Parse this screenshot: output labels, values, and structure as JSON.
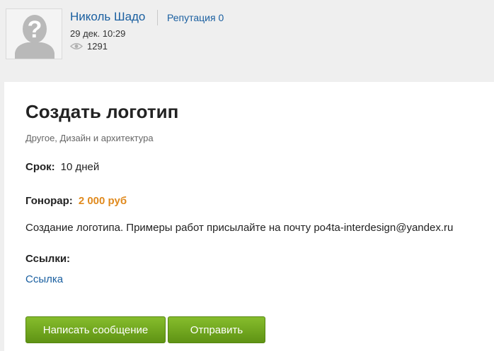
{
  "author": {
    "name": "Николь Шадо",
    "reputation": "Репутация 0",
    "date": "29 дек. 10:29",
    "views": "1291",
    "avatar_icon": "default-avatar-icon",
    "views_icon": "eye-icon"
  },
  "task": {
    "title": "Создать логотип",
    "categories": "Другое, Дизайн и архитектура",
    "deadline_label": "Срок:",
    "deadline_value": "10 дней",
    "fee_label": "Гонорар:",
    "fee_value": "2 000 руб",
    "description": "Создание логотипа. Примеры работ присылайте на почту po4ta-interdesign@yandex.ru",
    "links_heading": "Ссылки:",
    "link_label": "Ссылка"
  },
  "actions": {
    "message_label": "Написать сообщение",
    "send_label": "Отправить"
  },
  "colors": {
    "link": "#1a5fa0",
    "fee": "#e08a1e",
    "button": "#6fa51c",
    "background": "#efefef"
  }
}
